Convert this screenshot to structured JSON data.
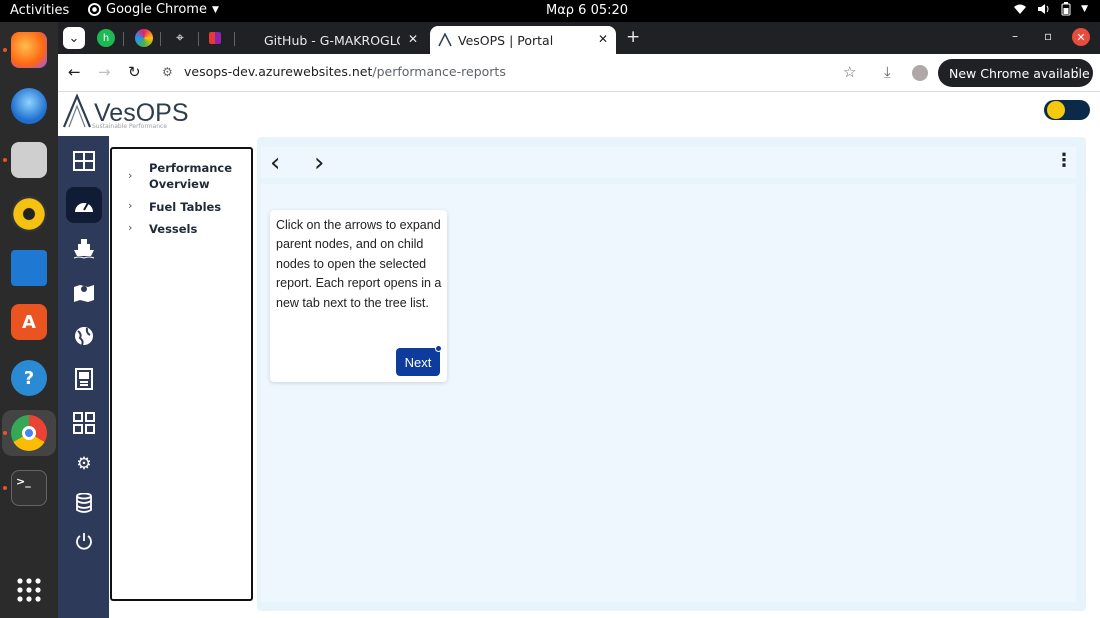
{
  "system": {
    "activities": "Activities",
    "app_name": "Google Chrome",
    "clock": "Μαρ 6  05:20"
  },
  "dock": {
    "apps": [
      "firefox-icon",
      "thunderbird-icon",
      "files-icon",
      "rhythmbox-icon",
      "writer-icon",
      "app-center-icon",
      "help-icon",
      "chrome-icon",
      "terminal-icon",
      "show-apps-icon"
    ],
    "terminal_glyph": ">_"
  },
  "browser": {
    "tabs": [
      {
        "title": "GitHub - G-MAKROGLOU",
        "active": false
      },
      {
        "title": "VesOPS | Portal",
        "active": true
      }
    ],
    "new_tab": "+",
    "url_host": "vesops-dev.azurewebsites.net",
    "url_path": "/performance-reports",
    "update_button": "New Chrome available"
  },
  "app": {
    "brand": "VesOPS",
    "tagline": "Sustainable Performance",
    "tree": [
      {
        "label": "Performance Overview"
      },
      {
        "label": "Fuel Tables"
      },
      {
        "label": "Vessels"
      }
    ],
    "tour": {
      "message": "Click on the arrows to expand parent nodes, and on child nodes to open the selected report. Each report opens in a new tab next to the tree list.",
      "next_label": "Next"
    }
  },
  "colors": {
    "app_nav": "#2e3a59",
    "report_bg": "#e8f4fc",
    "primary_button": "#0d3c9e"
  }
}
